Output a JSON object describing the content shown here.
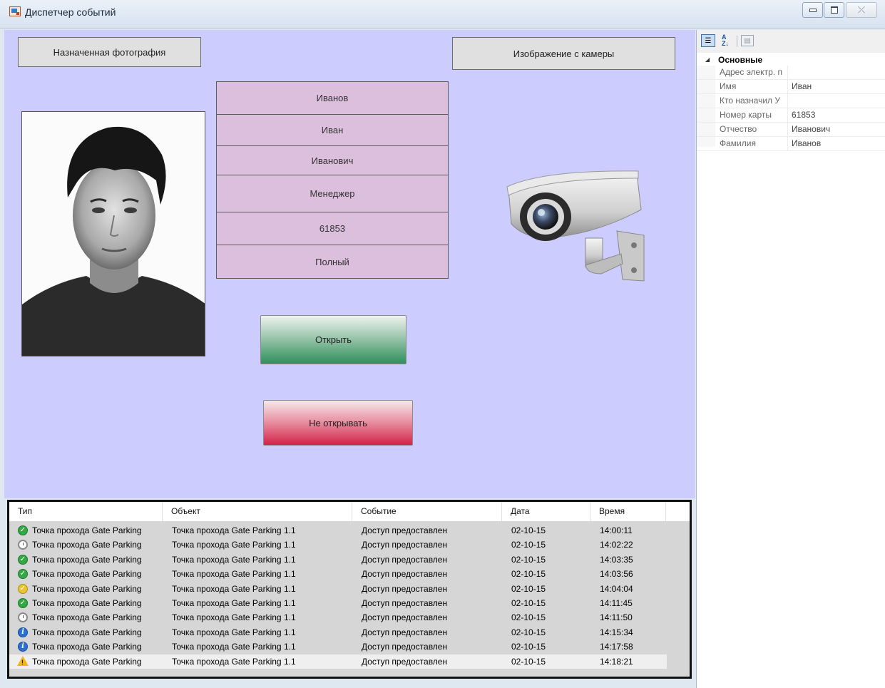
{
  "window": {
    "title": "Диспетчер событий",
    "minimize_label": "",
    "maximize_label": "",
    "close_label": "⤫"
  },
  "main": {
    "photo_button": "Назначенная фотография",
    "camera_button": "Изображение с камеры",
    "info_cells": [
      "Иванов",
      "Иван",
      "Иванович",
      "Менеджер",
      "61853",
      "Полный"
    ],
    "open_button": "Открыть",
    "noopen_button": "Не открывать"
  },
  "events": {
    "columns": [
      "Тип",
      "Объект",
      "Событие",
      "Дата",
      "Время"
    ],
    "rows": [
      {
        "icon": "check-green",
        "type": "Точка прохода Gate Parking",
        "object": "Точка прохода Gate Parking 1.1",
        "event": "Доступ предоставлен",
        "date": "02-10-15",
        "time": "14:00:11"
      },
      {
        "icon": "clock",
        "type": "Точка прохода Gate Parking",
        "object": "Точка прохода Gate Parking 1.1",
        "event": "Доступ предоставлен",
        "date": "02-10-15",
        "time": "14:02:22"
      },
      {
        "icon": "check-green",
        "type": "Точка прохода Gate Parking",
        "object": "Точка прохода Gate Parking 1.1",
        "event": "Доступ предоставлен",
        "date": "02-10-15",
        "time": "14:03:35"
      },
      {
        "icon": "check-green",
        "type": "Точка прохода Gate Parking",
        "object": "Точка прохода Gate Parking 1.1",
        "event": "Доступ предоставлен",
        "date": "02-10-15",
        "time": "14:03:56"
      },
      {
        "icon": "check-gold",
        "type": "Точка прохода Gate Parking",
        "object": "Точка прохода Gate Parking 1.1",
        "event": "Доступ предоставлен",
        "date": "02-10-15",
        "time": "14:04:04"
      },
      {
        "icon": "check-green",
        "type": "Точка прохода Gate Parking",
        "object": "Точка прохода Gate Parking 1.1",
        "event": "Доступ предоставлен",
        "date": "02-10-15",
        "time": "14:11:45"
      },
      {
        "icon": "clock",
        "type": "Точка прохода Gate Parking",
        "object": "Точка прохода Gate Parking 1.1",
        "event": "Доступ предоставлен",
        "date": "02-10-15",
        "time": "14:11:50"
      },
      {
        "icon": "info",
        "type": "Точка прохода Gate Parking",
        "object": "Точка прохода Gate Parking 1.1",
        "event": "Доступ предоставлен",
        "date": "02-10-15",
        "time": "14:15:34"
      },
      {
        "icon": "info",
        "type": "Точка прохода Gate Parking",
        "object": "Точка прохода Gate Parking 1.1",
        "event": "Доступ предоставлен",
        "date": "02-10-15",
        "time": "14:17:58"
      },
      {
        "icon": "warning",
        "type": "Точка прохода Gate Parking",
        "object": "Точка прохода Gate Parking 1.1",
        "event": "Доступ предоставлен",
        "date": "02-10-15",
        "time": "14:18:21"
      }
    ],
    "selected_index": 9
  },
  "properties": {
    "category": "Основные",
    "items": [
      {
        "name": "Адрес электр. п",
        "value": ""
      },
      {
        "name": "Имя",
        "value": "Иван"
      },
      {
        "name": "Кто назначил У",
        "value": ""
      },
      {
        "name": "Номер карты",
        "value": "61853"
      },
      {
        "name": "Отчество",
        "value": "Иванович"
      },
      {
        "name": "Фамилия",
        "value": "Иванов"
      }
    ]
  },
  "icons": {
    "check-green": "green-check-circle-icon",
    "check-gold": "gold-check-circle-icon",
    "clock": "clock-icon",
    "info": "info-circle-icon",
    "warning": "warning-triangle-icon"
  }
}
